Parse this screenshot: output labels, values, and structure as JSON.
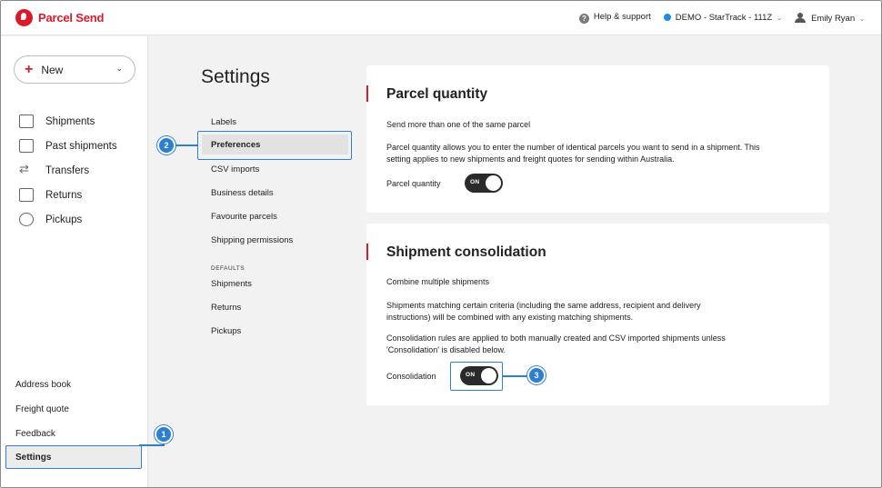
{
  "brand": {
    "name": "Parcel Send",
    "color": "#dc1928"
  },
  "topbar": {
    "help_label": "Help & support",
    "account_label": "DEMO - StarTrack - 111Z",
    "user_label": "Emily Ryan"
  },
  "sidebar": {
    "new_label": "New",
    "items": [
      {
        "label": "Shipments",
        "icon": "box-icon"
      },
      {
        "label": "Past shipments",
        "icon": "box-clock-icon"
      },
      {
        "label": "Transfers",
        "icon": "transfer-icon"
      },
      {
        "label": "Returns",
        "icon": "return-box-icon"
      },
      {
        "label": "Pickups",
        "icon": "clock-icon"
      }
    ],
    "bottom_items": [
      "Address book",
      "Freight quote",
      "Feedback"
    ],
    "settings_label": "Settings"
  },
  "settings_nav": {
    "title": "Settings",
    "items": [
      "Labels",
      "Preferences",
      "CSV imports",
      "Business details",
      "Favourite parcels",
      "Shipping permissions"
    ],
    "active": "Preferences",
    "defaults_heading": "DEFAULTS",
    "defaults_items": [
      "Shipments",
      "Returns",
      "Pickups"
    ]
  },
  "parcel_quantity": {
    "title": "Parcel quantity",
    "subtitle": "Send more than one of the same parcel",
    "description": "Parcel quantity allows you to enter the number of identical parcels you want to send in a shipment. This setting applies to new shipments and freight quotes for sending within Australia.",
    "toggle_label": "Parcel quantity",
    "toggle_state": "ON"
  },
  "consolidation": {
    "title": "Shipment consolidation",
    "subtitle": "Combine multiple shipments",
    "description1": "Shipments matching certain criteria (including the same address, recipient and delivery instructions) will be combined with any existing matching shipments.",
    "description2": "Consolidation rules are applied to both manually created and CSV imported shipments unless 'Consolidation' is disabled below.",
    "toggle_label": "Consolidation",
    "toggle_state": "ON"
  },
  "callouts": [
    "1",
    "2",
    "3"
  ],
  "colors": {
    "accent": "#dc1928",
    "highlight": "#2d7fd3",
    "account_dot": "#1f8ce6"
  }
}
